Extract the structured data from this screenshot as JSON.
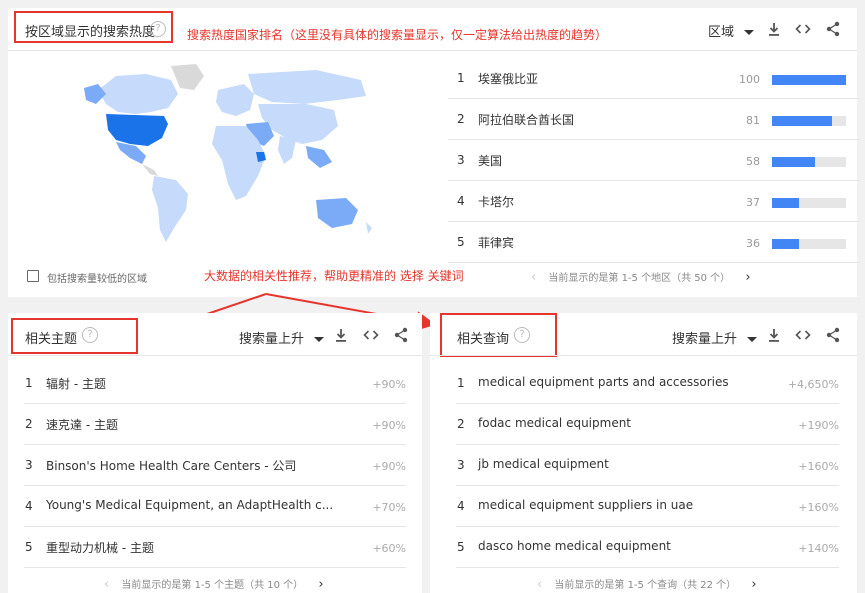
{
  "region_card": {
    "title": "按区域显示的搜索热度",
    "annotation": "搜索热度国家排名（这里没有具体的搜索量显示，仅一定算法给出热度的趋势）",
    "dropdown": "区域",
    "help": "?",
    "checkbox_label": "包括搜索量较低的区域",
    "pager": "当前显示的是第 1-5 个地区（共 50 个）",
    "rows": [
      {
        "rank": "1",
        "name": "埃塞俄比亚",
        "value": "100",
        "fill": 1.0
      },
      {
        "rank": "2",
        "name": "阿拉伯联合酋长国",
        "value": "81",
        "fill": 0.81
      },
      {
        "rank": "3",
        "name": "美国",
        "value": "58",
        "fill": 0.58
      },
      {
        "rank": "4",
        "name": "卡塔尔",
        "value": "37",
        "fill": 0.37
      },
      {
        "rank": "5",
        "name": "菲律宾",
        "value": "36",
        "fill": 0.36
      }
    ]
  },
  "middle_annotation": "大数据的相关性推荐，帮助更精准的 选择 关键词",
  "topics_card": {
    "title": "相关主题",
    "help": "?",
    "dropdown": "搜索量上升",
    "pager": "当前显示的是第 1-5 个主题（共 10 个）",
    "rows": [
      {
        "rank": "1",
        "name": "辐射 - 主题",
        "value": "+90%"
      },
      {
        "rank": "2",
        "name": "速克達 - 主题",
        "value": "+90%"
      },
      {
        "rank": "3",
        "name": "Binson's Home Health Care Centers - 公司",
        "value": "+90%"
      },
      {
        "rank": "4",
        "name": "Young's Medical Equipment, an AdaptHealth c...",
        "value": "+70%"
      },
      {
        "rank": "5",
        "name": "重型动力机械 - 主题",
        "value": "+60%"
      }
    ]
  },
  "queries_card": {
    "title": "相关查询",
    "help": "?",
    "dropdown": "搜索量上升",
    "pager": "当前显示的是第 1-5 个查询（共 22 个）",
    "rows": [
      {
        "rank": "1",
        "name": "medical equipment parts and accessories",
        "value": "+4,650%"
      },
      {
        "rank": "2",
        "name": "fodac medical equipment",
        "value": "+190%"
      },
      {
        "rank": "3",
        "name": "jb medical equipment",
        "value": "+160%"
      },
      {
        "rank": "4",
        "name": "medical equipment suppliers in uae",
        "value": "+160%"
      },
      {
        "rank": "5",
        "name": "dasco home medical equipment",
        "value": "+140%"
      }
    ]
  },
  "colors": {
    "accent": "#4285f4",
    "annotation": "#e5352c",
    "map_high": "#1a73e8",
    "map_mid": "#7baaf7",
    "map_low": "#c6dafc",
    "map_none": "#d9d9d9"
  },
  "icons": [
    "help-icon",
    "download-icon",
    "embed-icon",
    "share-icon",
    "chevron-left-icon",
    "chevron-right-icon"
  ]
}
